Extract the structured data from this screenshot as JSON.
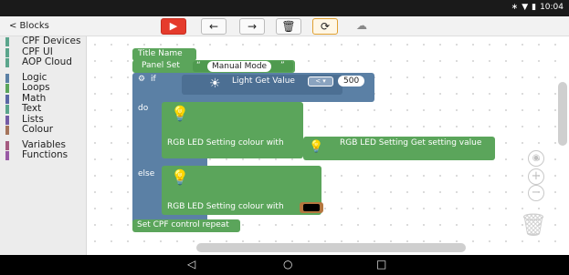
{
  "status_bar": {
    "icons": [
      "bluetooth-icon",
      "wifi-icon",
      "battery-icon"
    ],
    "time": "10:04"
  },
  "toolbar": {
    "back_label": "< Blocks",
    "buttons": [
      "play-icon",
      "arrow-left-icon",
      "arrow-right-icon",
      "trash-icon",
      "sync-icon",
      "cloud-icon"
    ]
  },
  "sidebar": {
    "categories": [
      {
        "label": "CPF Devices",
        "color": "#5ba58c"
      },
      {
        "label": "CPF UI",
        "color": "#5ba58c"
      },
      {
        "label": "AOP Cloud",
        "color": "#5ba58c"
      },
      {
        "label": "Logic",
        "color": "#5b80a5"
      },
      {
        "label": "Loops",
        "color": "#5ba55b"
      },
      {
        "label": "Math",
        "color": "#5b67a5"
      },
      {
        "label": "Text",
        "color": "#5ba58c"
      },
      {
        "label": "Lists",
        "color": "#745ba5"
      },
      {
        "label": "Colour",
        "color": "#a5745b"
      },
      {
        "label": "Variables",
        "color": "#a55b80"
      },
      {
        "label": "Functions",
        "color": "#995ba5"
      }
    ]
  },
  "workspace": {
    "title_block": "Title Name",
    "panel_set": "Panel Set",
    "panel_value": "Manual Mode",
    "if_label": "if",
    "light_get_value": "Light  Get Value",
    "light_compare": "<",
    "light_threshold": "500",
    "do_label": "do",
    "else_label": "else",
    "rgb_setting_colour_with": "RGB LED Setting   colour with",
    "rgb_get_setting_value": "RGB LED Setting   Get setting value",
    "rgb_setting_colour_with_2": "RGB LED Setting   colour with",
    "set_repeat": "Set CPF control repeat",
    "colour_swatch": "#000000"
  },
  "colors": {
    "block_green": "#5ba55b",
    "block_blue": "#5b80a5",
    "play_red": "#e53b2c"
  }
}
